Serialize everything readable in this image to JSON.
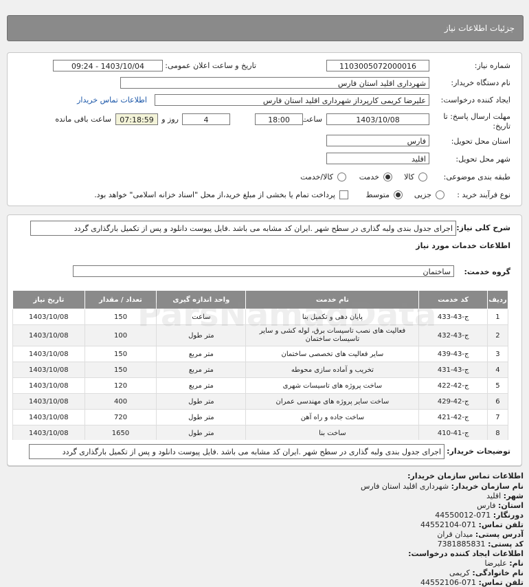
{
  "header": {
    "title": "جزئیات اطلاعات نیاز"
  },
  "form": {
    "need_number_label": "شماره نیاز:",
    "need_number": "1103005072000016",
    "announce_label": "تاریخ و ساعت اعلان عمومی:",
    "announce_value": "1403/10/04 - 09:24",
    "buyer_label": "نام دستگاه خریدار:",
    "buyer_value": "شهرداری اقلید استان فارس",
    "creator_label": "ایجاد کننده درخواست:",
    "creator_value": "علیرضا کریمی  کارپرداز شهرداری اقلید استان فارس",
    "contact_link": "اطلاعات تماس خریدار",
    "deadline_label_1": "مهلت ارسال پاسخ: تا",
    "deadline_label_2": "تاریخ:",
    "deadline_date": "1403/10/08",
    "time_label": "ساعت",
    "deadline_time": "18:00",
    "days_value": "4",
    "days_label": "روز و",
    "remaining_time": "07:18:59",
    "remaining_label": "ساعت باقی مانده",
    "province_label": "استان محل تحویل:",
    "province_value": "فارس",
    "city_label": "شهر محل تحویل:",
    "city_value": "اقلید",
    "category_label": "طبقه بندی موضوعی:",
    "category_options": [
      "کالا",
      "خدمت",
      "کالا/خدمت"
    ],
    "category_selected": "خدمت",
    "process_label": "نوع فرآیند خرید :",
    "process_options": [
      "جزیی",
      "متوسط"
    ],
    "process_selected": "متوسط",
    "payment_note": "پرداخت تمام یا بخشی از مبلغ خرید،از محل \"اسناد خزانه اسلامی\" خواهد بود."
  },
  "description": {
    "label": "شرح کلی نیاز:",
    "text": "اجرای جدول بندی ولبه گذاری در سطح شهر .ایران کد مشابه می باشد .فایل پیوست دانلود و پس از تکمیل بارگذاری گردد",
    "services_heading": "اطلاعات خدمات مورد نیاز",
    "group_label": "گروه خدمت:",
    "group_value": "ساختمان"
  },
  "table": {
    "headers": [
      "ردیف",
      "کد خدمت",
      "نام خدمت",
      "واحد اندازه گیری",
      "تعداد / مقدار",
      "تاریخ نیاز"
    ],
    "rows": [
      [
        "1",
        "ج-43-433",
        "پایان دهی و تکمیل بنا",
        "ساعت",
        "150",
        "1403/10/08"
      ],
      [
        "2",
        "ج-43-432",
        "فعالیت های نصب تاسیسات برق، لوله کشی و سایر تاسیسات ساختمان",
        "متر طول",
        "100",
        "1403/10/08"
      ],
      [
        "3",
        "ج-43-439",
        "سایر فعالیت های تخصصی ساختمان",
        "متر مربع",
        "150",
        "1403/10/08"
      ],
      [
        "4",
        "ج-43-431",
        "تخریب و آماده سازی محوطه",
        "متر مربع",
        "150",
        "1403/10/08"
      ],
      [
        "5",
        "ج-42-422",
        "ساخت پروژه های تاسیسات شهری",
        "متر مربع",
        "120",
        "1403/10/08"
      ],
      [
        "6",
        "ج-42-429",
        "ساخت سایر پروژه های مهندسی عمران",
        "متر طول",
        "400",
        "1403/10/08"
      ],
      [
        "7",
        "ج-42-421",
        "ساخت جاده و راه آهن",
        "متر طول",
        "720",
        "1403/10/08"
      ],
      [
        "8",
        "ج-41-410",
        "ساخت بنا",
        "متر طول",
        "1650",
        "1403/10/08"
      ]
    ]
  },
  "buyer_notes": {
    "label": "توضیحات خریدار:",
    "text": "اجرای جدول بندی ولبه گذاری در سطح شهر .ایران کد مشابه می باشد .فایل پیوست دانلود و پس از تکمیل بارگذاری گردد"
  },
  "contact": {
    "heading": "اطلاعات تماس سازمان خریدار:",
    "org_label": "نام سازمان خریدار:",
    "org_value": "شهرداری اقلید استان فارس",
    "city_label": "شهر:",
    "city_value": "اقلید",
    "province_label": "استان:",
    "province_value": "فارس",
    "fax_label": "دورنگار:",
    "fax_value": "071-44550012",
    "phone_label": "تلفن تماس:",
    "phone_value": "071-44552104",
    "address_label": "آدرس پستی:",
    "address_value": "میدان قران",
    "postal_label": "کد پستی:",
    "postal_value": "7381885831",
    "creator_heading": "اطلاعات ایجاد کننده درخواست:",
    "name_label": "نام:",
    "name_value": "علیرضا",
    "family_label": "نام خانوادگی:",
    "family_value": "کریمی",
    "phone2_label": "تلفن تماس:",
    "phone2_value": "071-44552106"
  },
  "watermark": {
    "text": "ParsNamadData"
  }
}
